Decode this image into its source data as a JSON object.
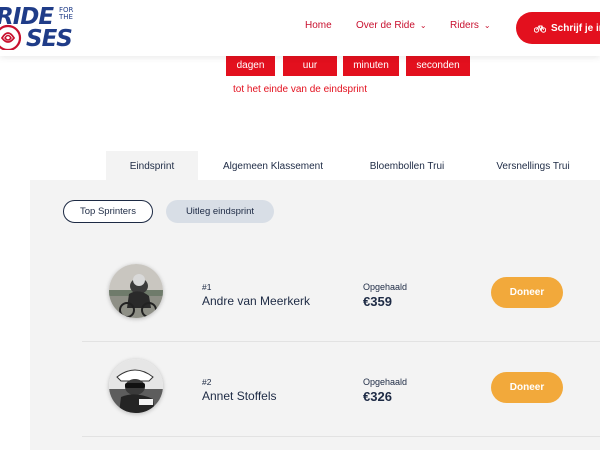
{
  "logo": {
    "line1": "RIDE",
    "line2": "SES",
    "small": "FOR THE"
  },
  "nav": {
    "items": [
      {
        "label": "Home",
        "dropdown": false
      },
      {
        "label": "Over de Ride",
        "dropdown": true
      },
      {
        "label": "Riders",
        "dropdown": true
      }
    ],
    "cta_label": "Schrijf je in"
  },
  "countdown": {
    "units": [
      "dagen",
      "uur",
      "minuten",
      "seconden"
    ],
    "caption": "tot het einde van de eindsprint"
  },
  "tabs": [
    {
      "label": "Eindsprint",
      "active": true
    },
    {
      "label": "Algemeen Klassement",
      "active": false
    },
    {
      "label": "Bloembollen Trui",
      "active": false
    },
    {
      "label": "Versnellings Trui",
      "active": false
    }
  ],
  "pills": {
    "top": "Top Sprinters",
    "explain": "Uitleg eindsprint"
  },
  "riders": [
    {
      "rank": "#1",
      "name": "Andre van Meerkerk",
      "raised_label": "Opgehaald",
      "raised": "€359",
      "donate": "Doneer"
    },
    {
      "rank": "#2",
      "name": "Annet Stoffels",
      "raised_label": "Opgehaald",
      "raised": "€326",
      "donate": "Doneer"
    }
  ],
  "colors": {
    "brand_red": "#e3101e",
    "navy": "#1d2a44",
    "donate_orange": "#f2a93b",
    "panel_gray": "#f3f3f3"
  }
}
